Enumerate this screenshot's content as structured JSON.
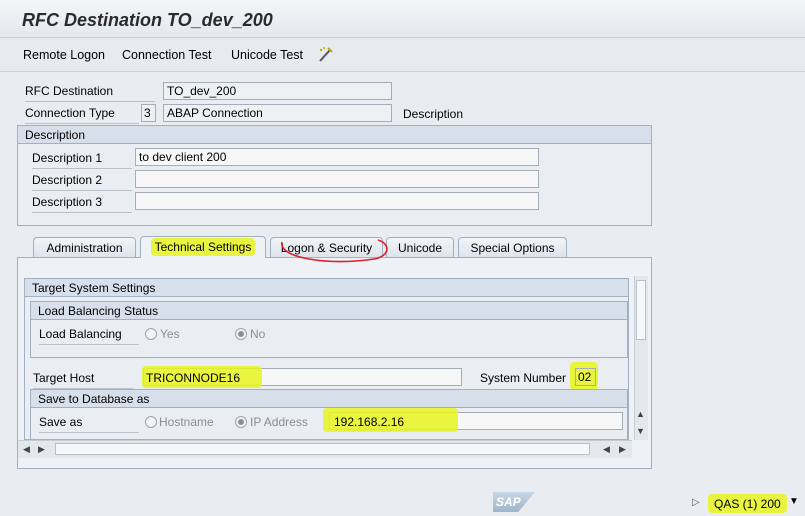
{
  "window": {
    "title": "RFC Destination TO_dev_200"
  },
  "toolbar": {
    "remote_logon": "Remote Logon",
    "connection_test": "Connection Test",
    "unicode_test": "Unicode Test",
    "tool_icon": "pencil-wand-icon"
  },
  "header": {
    "rfc_destination_label": "RFC Destination",
    "rfc_destination_value": "TO_dev_200",
    "connection_type_label": "Connection Type",
    "connection_type_code": "3",
    "connection_type_value": "ABAP Connection",
    "description_link": "Description"
  },
  "description_group": {
    "title": "Description",
    "rows": [
      {
        "label": "Description 1",
        "value": "to dev client 200"
      },
      {
        "label": "Description 2",
        "value": ""
      },
      {
        "label": "Description 3",
        "value": ""
      }
    ]
  },
  "tabs": [
    {
      "label": "Administration",
      "active": false
    },
    {
      "label": "Technical Settings",
      "active": true
    },
    {
      "label": "Logon & Security",
      "active": false
    },
    {
      "label": "Unicode",
      "active": false
    },
    {
      "label": "Special Options",
      "active": false
    }
  ],
  "target_system": {
    "section_title": "Target System Settings",
    "load_balancing_group": "Load Balancing Status",
    "load_balancing_label": "Load Balancing",
    "yes_label": "Yes",
    "no_label": "No",
    "selected": "No",
    "target_host_label": "Target Host",
    "target_host_value": "TRICONNODE16",
    "system_number_label": "System Number",
    "system_number_value": "02",
    "save_group": "Save to Database as",
    "save_as_label": "Save as",
    "hostname_label": "Hostname",
    "ip_label": "IP Address",
    "save_selected": "IP Address",
    "ip_value": "192.168.2.16"
  },
  "statusbar": {
    "logo": "SAP",
    "system": "QAS (1) 200"
  },
  "colors": {
    "highlight": "#e8f520",
    "annotation": "#e0202a",
    "group_header": "#d7e0ea"
  }
}
